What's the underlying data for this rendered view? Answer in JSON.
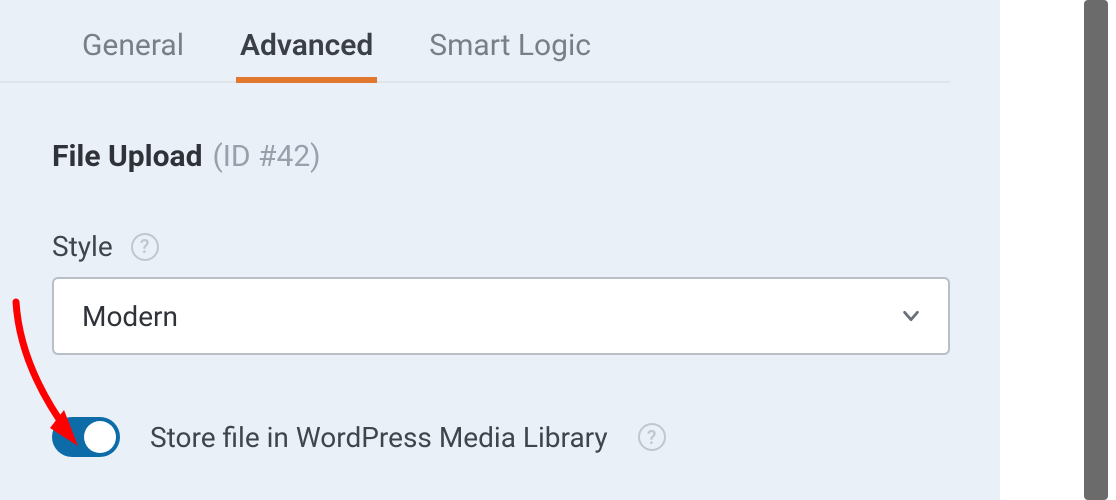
{
  "tabs": {
    "general": "General",
    "advanced": "Advanced",
    "smart_logic": "Smart Logic",
    "active": "advanced"
  },
  "section": {
    "title": "File Upload",
    "id_label": "(ID #42)"
  },
  "style": {
    "label": "Style",
    "value": "Modern"
  },
  "media_library": {
    "label": "Store file in WordPress Media Library",
    "state": "on"
  },
  "colors": {
    "accent": "#e27730",
    "toggle_on": "#0d6ca8",
    "annotation": "#ff0000"
  }
}
